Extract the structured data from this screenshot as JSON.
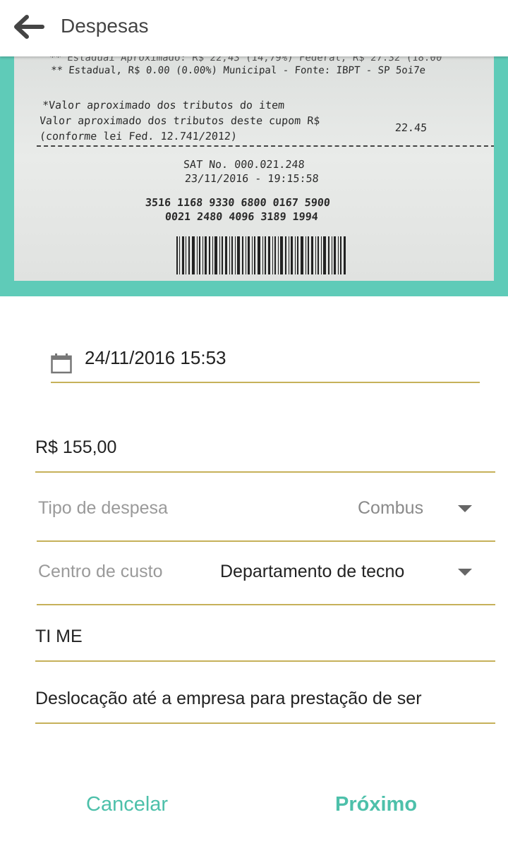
{
  "header": {
    "title": "Despesas",
    "back_icon": "arrow-left-icon"
  },
  "receipt_photo": {
    "lines": [
      "** Estadual, R$ 0.00 (0.00%) Municipal - Fonte: IBPT - SP  5oi7e",
      "*Valor aproximado dos tributos do item",
      "Valor aproximado dos tributos deste cupom R$",
      "22.45",
      "(conforme lei Fed. 12.741/2012)",
      "SAT No. 000.021.248",
      "23/11/2016 - 19:15:58",
      "3516  1168  9330  6800  0167  5900",
      "0021  2480  4096  3189  1994"
    ]
  },
  "form": {
    "date": {
      "value": "24/11/2016 15:53",
      "icon": "calendar-icon"
    },
    "amount": {
      "value": "R$ 155,00"
    },
    "expense_type": {
      "label": "Tipo de despesa",
      "value": "Combus"
    },
    "cost_center": {
      "label": "Centro de custo",
      "value": "Departamento de tecno"
    },
    "establishment": {
      "value": "TI ME"
    },
    "description": {
      "value": "Deslocação até a empresa para prestação de ser"
    }
  },
  "actions": {
    "cancel_label": "Cancelar",
    "next_label": "Próximo"
  },
  "colors": {
    "accent": "#4dc0aa",
    "frame": "#5fcbb8",
    "underline": "#c6b15a"
  }
}
